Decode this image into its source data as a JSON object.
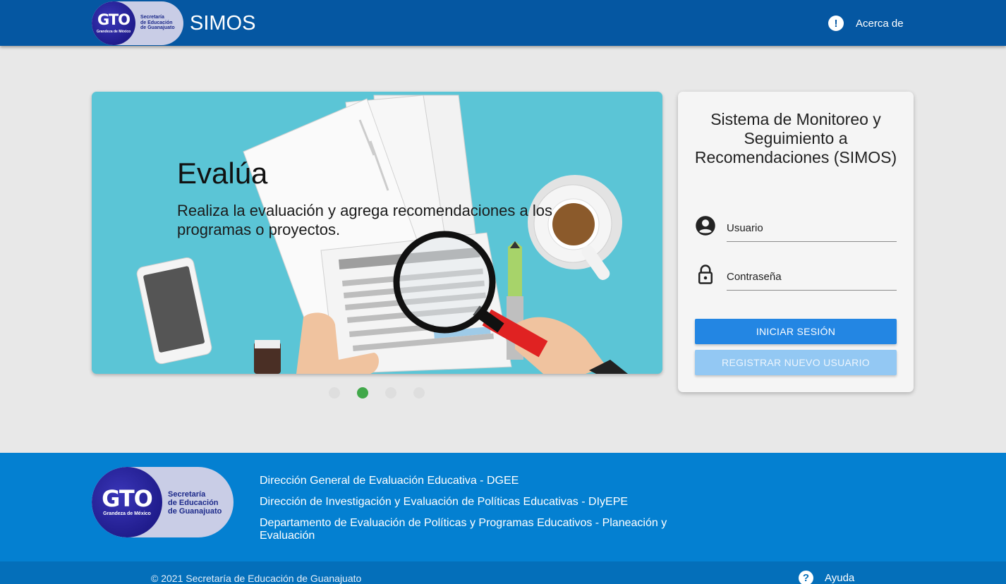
{
  "header": {
    "logo": {
      "brand": "GTO",
      "tagline": "Grandeza de México",
      "org_lines": [
        "Secretaría",
        "de Educación",
        "de Guanajuato"
      ]
    },
    "app_title": "SIMOS",
    "about_label": "Acerca de",
    "about_icon": "info-exclamation-icon"
  },
  "carousel": {
    "slide_title": "Evalúa",
    "slide_text": "Realiza la evaluación y agrega recomendaciones a los programas o proyectos.",
    "slide_count": 4,
    "active_slide": 2
  },
  "login": {
    "title": "Sistema de Monitoreo y Seguimiento a Recomendaciones (SIMOS)",
    "username_placeholder": "Usuario",
    "password_placeholder": "Contraseña",
    "username_icon": "account-circle-icon",
    "password_icon": "lock-icon",
    "login_button": "INICIAR SESIÓN",
    "register_button": "REGISTRAR NUEVO USUARIO"
  },
  "footer": {
    "links": [
      "Dirección General de Evaluación Educativa - DGEE",
      "Dirección de Investigación y Evaluación de Políticas Educativas - DIyEPE",
      "Departamento de Evaluación de Políticas y Programas Educativos - Planeación y Evaluación"
    ],
    "copyright": "© 2021 Secretaría de Educación de Guanajuato",
    "help_label": "Ayuda",
    "help_icon": "help-circle-icon"
  },
  "colors": {
    "header": "#0557a2",
    "footer": "#0480d1",
    "bottom_bar": "#046fba",
    "primary_button": "#2386e3",
    "active_dot": "#41a84a"
  }
}
